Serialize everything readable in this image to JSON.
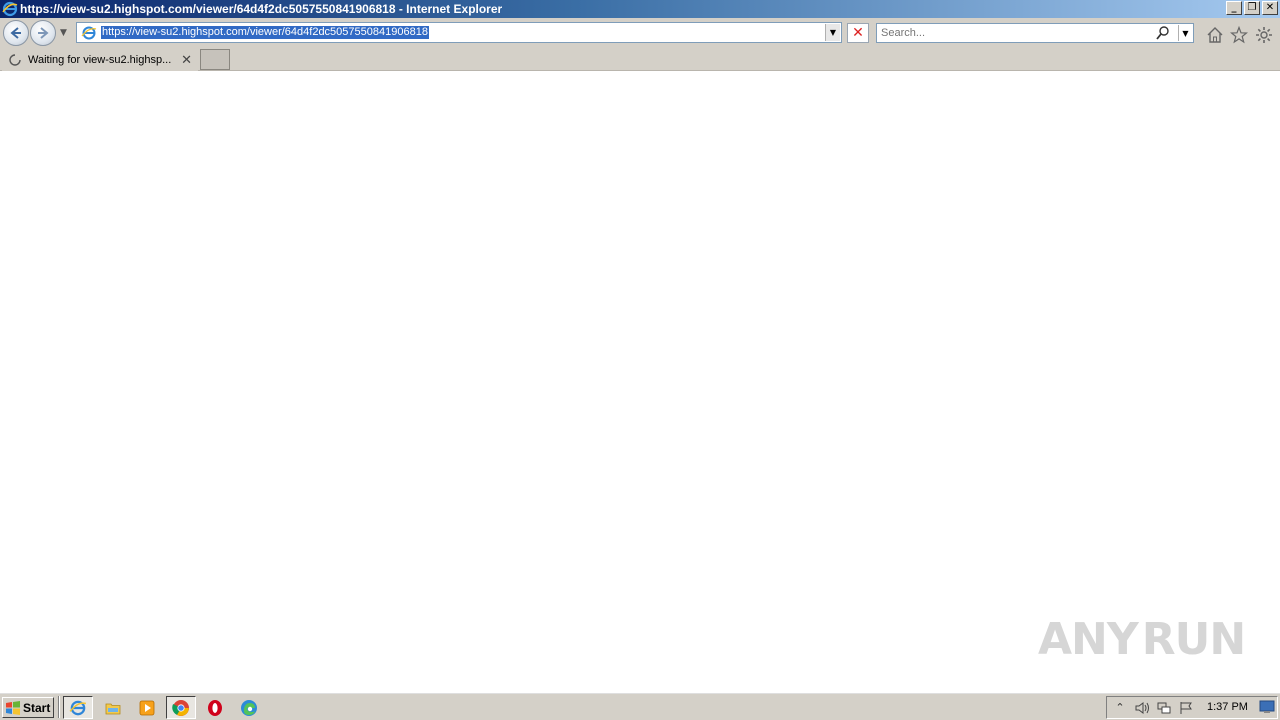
{
  "window": {
    "title": "https://view-su2.highspot.com/viewer/64d4f2dc5057550841906818 - Internet Explorer",
    "buttons": {
      "minimize": "_",
      "restore": "❐",
      "close": "✕"
    }
  },
  "toolbar": {
    "address_url": "https://view-su2.highspot.com/viewer/64d4f2dc5057550841906818",
    "search_placeholder": "Search...",
    "icons": [
      "back-icon",
      "forward-icon",
      "stop-icon",
      "search-icon",
      "home-icon",
      "favorites-star-icon",
      "settings-gear-icon"
    ]
  },
  "tabs": [
    {
      "label": "Waiting for view-su2.highsp...",
      "loading": true
    }
  ],
  "watermark": {
    "left": "ANY",
    "right": "RUN"
  },
  "taskbar": {
    "start_label": "Start",
    "apps": [
      "internet-explorer",
      "file-explorer",
      "media-player",
      "chrome",
      "opera",
      "edge"
    ],
    "clock": "1:37 PM"
  },
  "colors": {
    "titlebar_start": "#0a246a",
    "chrome_bg": "#d4d0c8",
    "url_highlight": "#316ac5",
    "stop_red": "#d22222"
  }
}
